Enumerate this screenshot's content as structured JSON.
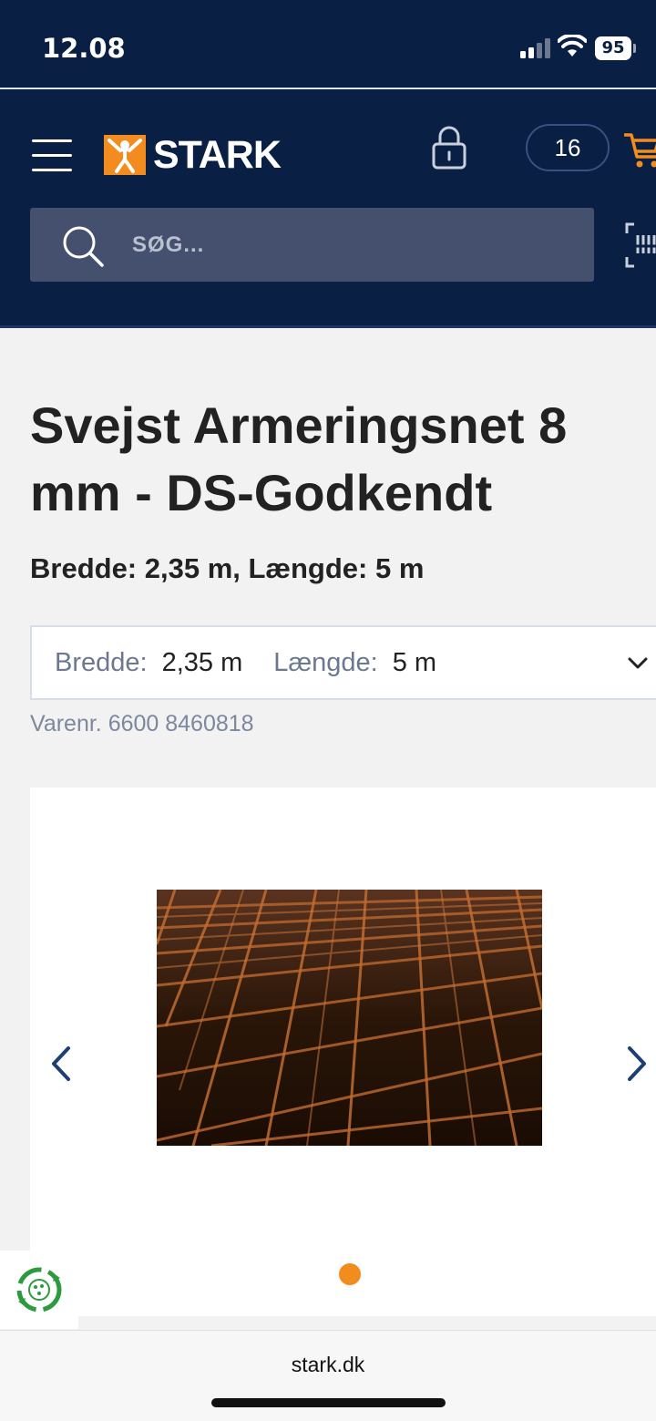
{
  "status_bar": {
    "time": "12.08",
    "battery": "95"
  },
  "header": {
    "brand": "STARK",
    "cart_count": "16",
    "search": {
      "placeholder": "SØG..."
    }
  },
  "product": {
    "title": "Svejst Armeringsnet 8 mm - DS-Godkendt",
    "subtitle": "Bredde: 2,35 m, Længde: 5 m",
    "variant": {
      "width_label": "Bredde:",
      "width_value": "2,35 m",
      "length_label": "Længde:",
      "length_value": "5 m"
    },
    "sku": "Varenr. 6600 8460818"
  },
  "browser": {
    "url": "stark.dk"
  },
  "colors": {
    "navy": "#0a1f44",
    "accent": "#f28c1e",
    "search_bg": "#44506d"
  }
}
